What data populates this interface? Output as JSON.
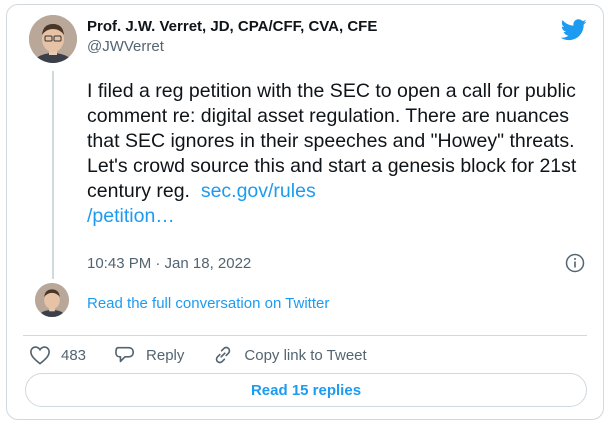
{
  "author": {
    "name": "Prof. J.W. Verret, JD, CPA/CFF, CVA, CFE",
    "handle": "@JWVerret"
  },
  "tweet": {
    "text": "I filed a reg petition with the SEC to open a call for public comment re: digital asset regulation. There are nuances that SEC ignores in their speeches and \"Howey\" threats. Let's crowd source this and start a genesis block for 21st century reg.",
    "link_line1": "sec.gov/rules",
    "link_line2": "/petition…",
    "timestamp": "10:43 PM · Jan 18, 2022"
  },
  "conversation_link": "Read the full conversation on Twitter",
  "actions": {
    "like_count": "483",
    "reply_label": "Reply",
    "copy_link_label": "Copy link to Tweet"
  },
  "read_replies_label": "Read 15 replies",
  "colors": {
    "accent": "#1d9bf0",
    "text": "#0f1419",
    "secondary": "#536471",
    "border": "#cfd9de"
  },
  "icons": [
    "twitter-bird-icon",
    "info-icon",
    "heart-icon",
    "reply-icon",
    "link-icon"
  ]
}
